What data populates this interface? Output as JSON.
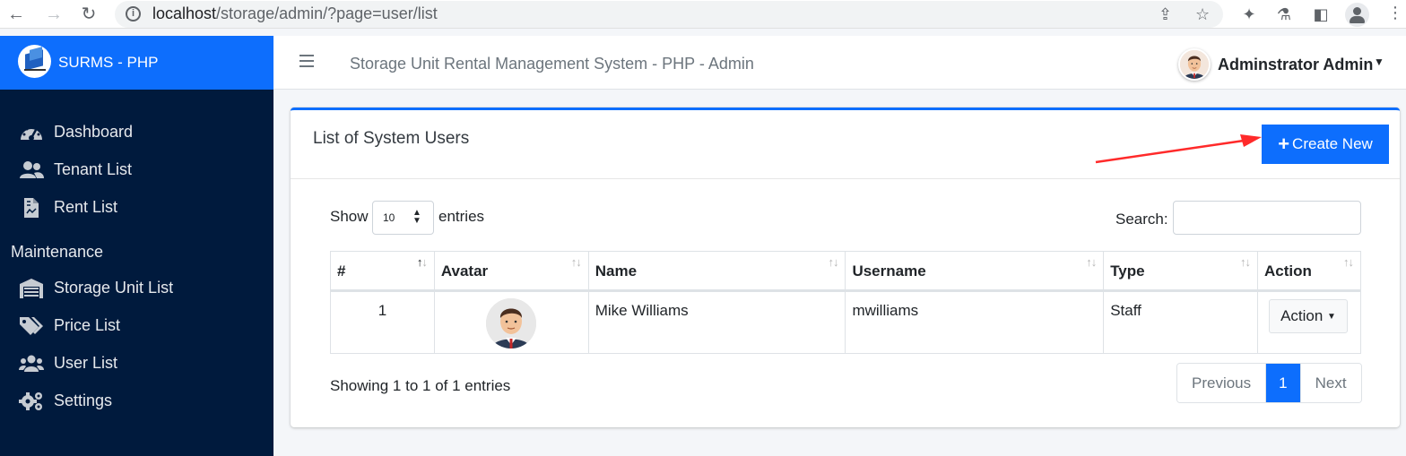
{
  "browser": {
    "url_host": "localhost",
    "url_path": "/storage/admin/?page=user/list"
  },
  "brand": {
    "title": "SURMS - PHP"
  },
  "sidebar": {
    "items": [
      {
        "label": "Dashboard",
        "icon": "tachometer-icon"
      },
      {
        "label": "Tenant List",
        "icon": "users-icon"
      },
      {
        "label": "Rent List",
        "icon": "file-invoice-icon"
      }
    ],
    "section_header": "Maintenance",
    "maintenance_items": [
      {
        "label": "Storage Unit List",
        "icon": "warehouse-icon"
      },
      {
        "label": "Price List",
        "icon": "tags-icon"
      },
      {
        "label": "User List",
        "icon": "users-group-icon"
      },
      {
        "label": "Settings",
        "icon": "gears-icon"
      }
    ]
  },
  "header": {
    "system_title": "Storage Unit Rental Management System - PHP - Admin",
    "user_name": "Adminstrator Admin"
  },
  "card": {
    "title": "List of System Users",
    "create_label": "Create New"
  },
  "table_controls": {
    "show_label": "Show",
    "entries_value": "10",
    "entries_label": "entries",
    "search_label": "Search:",
    "search_value": ""
  },
  "table": {
    "columns": [
      "#",
      "Avatar",
      "Name",
      "Username",
      "Type",
      "Action"
    ],
    "rows": [
      {
        "index": "1",
        "name": "Mike Williams",
        "username": "mwilliams",
        "type": "Staff",
        "action": "Action"
      }
    ]
  },
  "footer": {
    "showing": "Showing 1 to 1 of 1 entries",
    "previous": "Previous",
    "page": "1",
    "next": "Next"
  },
  "colors": {
    "primary": "#0d6efd",
    "sidebar": "#001a3d",
    "annotation_arrow": "#ff2a2a"
  }
}
